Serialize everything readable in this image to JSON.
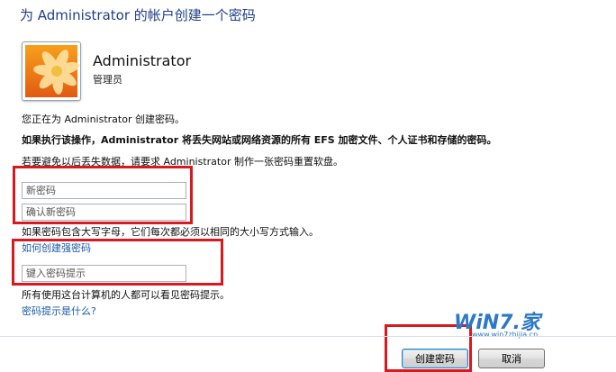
{
  "window": {
    "title": "为 Administrator 的帐户创建一个密码"
  },
  "account": {
    "name": "Administrator",
    "role": "管理员",
    "avatar_icon": "flower-avatar-icon"
  },
  "text": {
    "creating_for": "您正在为 Administrator 创建密码。",
    "warning": "如果执行该操作，Administrator 将丢失网站或网络资源的所有 EFS 加密文件、个人证书和存储的密码。",
    "reset_disk": "若要避免以后丢失数据，请要求 Administrator 制作一张密码重置软盘。",
    "case_note": "如果密码包含大写字母，它们每次都必须以相同的大小写方式输入。",
    "hint_visible": "所有使用这台计算机的人都可以看见密码提示。"
  },
  "fields": {
    "new_password_placeholder": "新密码",
    "confirm_password_placeholder": "确认新密码",
    "hint_placeholder": "键入密码提示"
  },
  "links": {
    "strong_password": "如何创建强密码",
    "what_is_hint": "密码提示是什么?"
  },
  "buttons": {
    "create": "创建密码",
    "cancel": "取消"
  },
  "watermark": {
    "brand": "WiN7.家",
    "url": "www.win7zhijia.cn"
  },
  "colors": {
    "title": "#1e3e8a",
    "link": "#1a5aa8",
    "highlight": "#d71920"
  }
}
